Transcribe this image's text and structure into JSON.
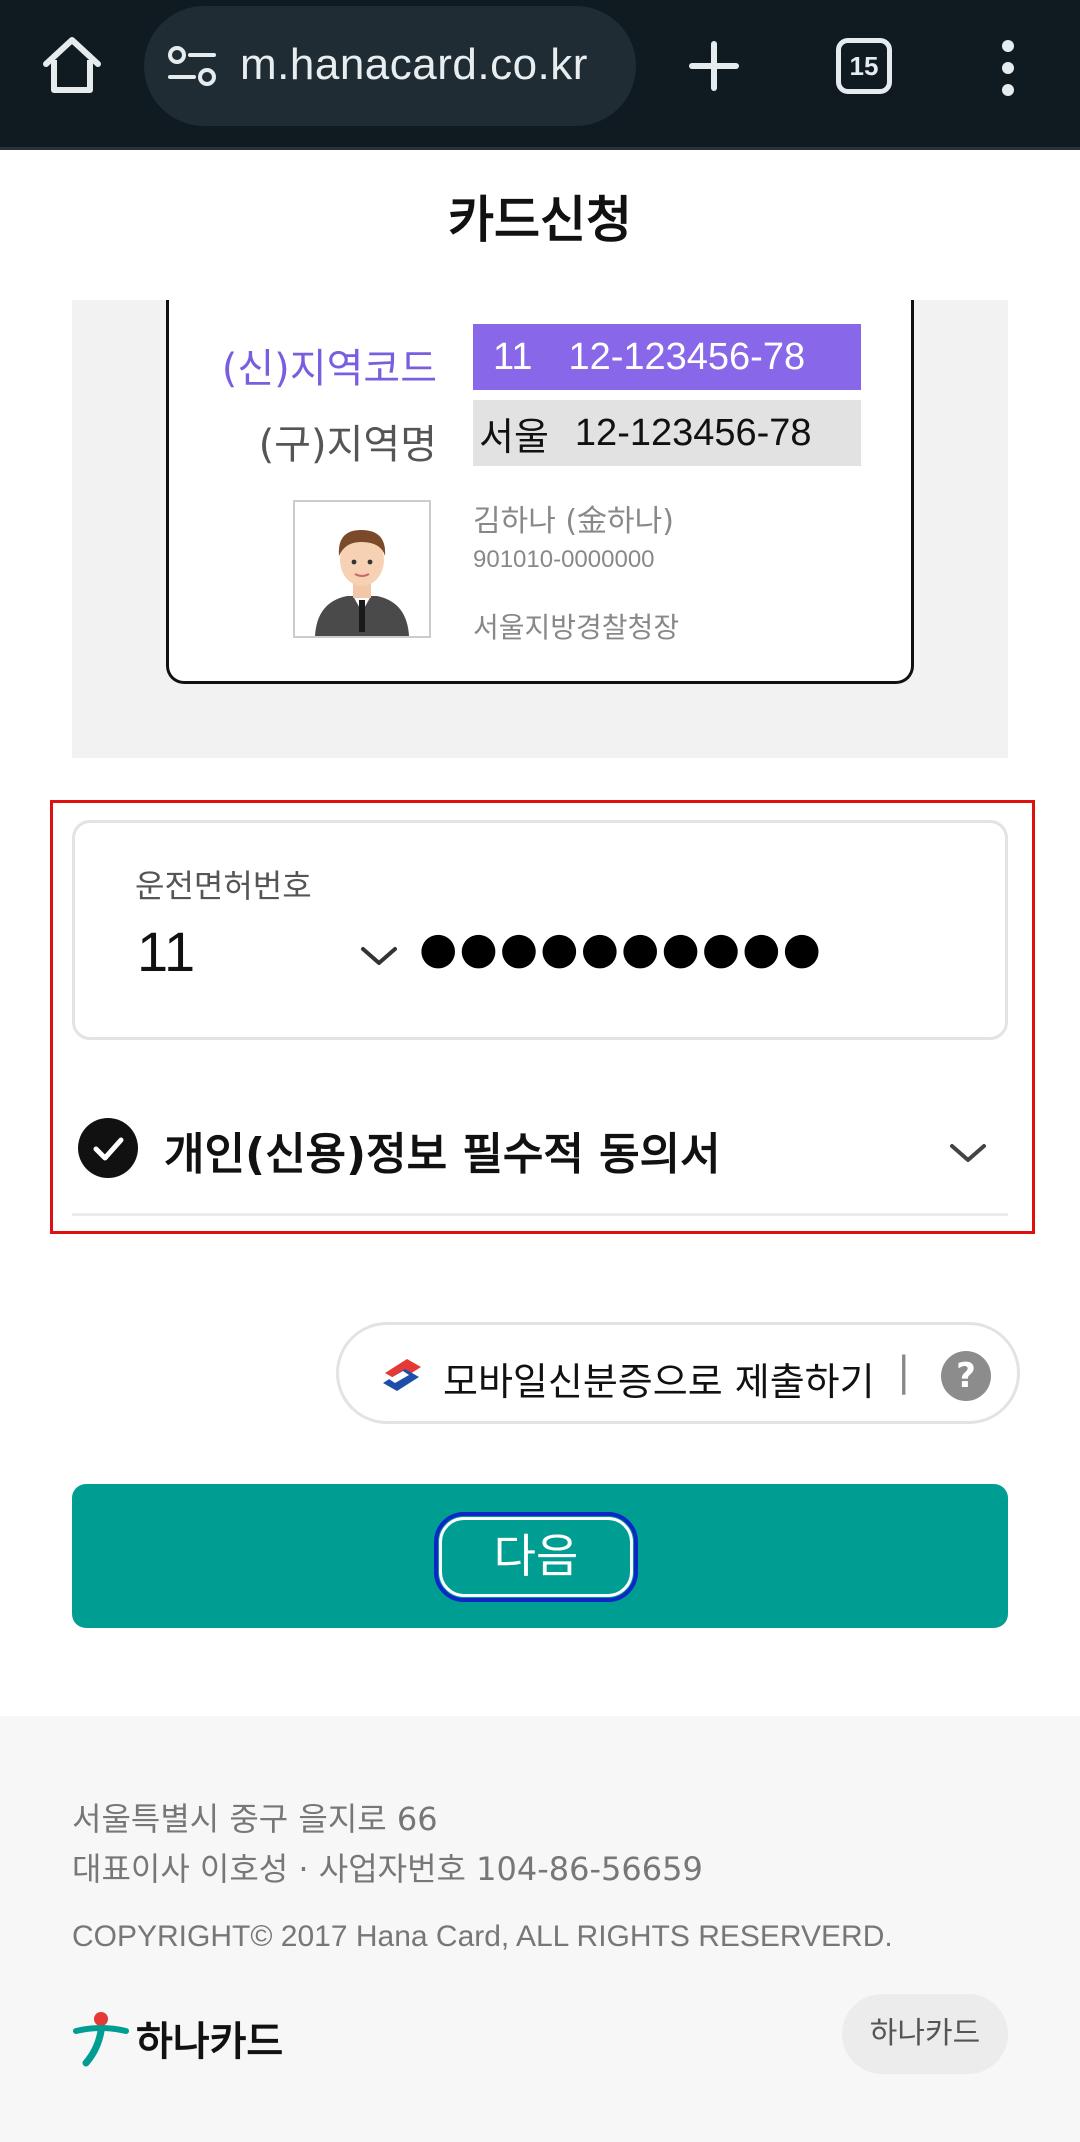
{
  "browser": {
    "url": "m.hanacard.co.kr",
    "tab_count": "15"
  },
  "page": {
    "title": "카드신청"
  },
  "license_card": {
    "new_region_label": "(신)지역코드",
    "new_region_code": "11",
    "new_number": "12-123456-78",
    "old_region_label": "(구)지역명",
    "old_region_name": "서울",
    "old_number": "12-123456-78",
    "holder_name": "김하나 (金하나)",
    "holder_id": "901010-0000000",
    "issuer": "서울지방경찰청장"
  },
  "license_input": {
    "label": "운전면허번호",
    "region_value": "11",
    "masked_number": "●●●●●●●●●●"
  },
  "consent": {
    "label": "개인(신용)정보 필수적 동의서",
    "checked": true
  },
  "mobile_id": {
    "label": "모바일신분증으로 제출하기",
    "separator": "|",
    "help": "?"
  },
  "next_button": {
    "label": "다음"
  },
  "footer": {
    "address": "서울특별시 중구 을지로 66",
    "ceo_info": "대표이사 이호성 · 사업자번호 104-86-56659",
    "copyright": "COPYRIGHT© 2017 Hana Card, ALL RIGHTS RESERVERD.",
    "logo_text": "하나카드",
    "brand_button": "하나카드"
  },
  "colors": {
    "accent_teal": "#009d92",
    "purple": "#8868e8",
    "highlight_red": "#e11010"
  }
}
